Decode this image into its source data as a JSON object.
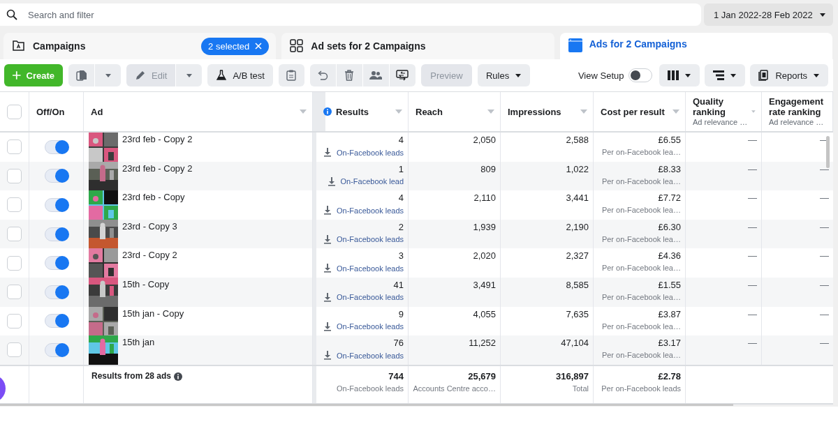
{
  "search": {
    "placeholder": "Search and filter"
  },
  "date_range": {
    "label": "1 Jan 2022-28 Feb 2022"
  },
  "tabs": [
    {
      "label": "Campaigns",
      "selected": false,
      "badge": "2 selected"
    },
    {
      "label": "Ad sets for 2 Campaigns",
      "selected": false
    },
    {
      "label": "Ads for 2 Campaigns",
      "selected": true
    }
  ],
  "toolbar": {
    "create": {
      "label": "Create"
    },
    "edit": {
      "label": "Edit",
      "disabled": true
    },
    "ab_test": {
      "label": "A/B test"
    },
    "preview": {
      "label": "Preview",
      "disabled": true
    },
    "rules": {
      "label": "Rules"
    },
    "view_setup": {
      "label": "View Setup",
      "on": false
    },
    "reports": {
      "label": "Reports"
    }
  },
  "table": {
    "select_all_checked": false,
    "columns": [
      {
        "label": "Off/On"
      },
      {
        "label": "Ad"
      },
      {
        "label": "Results",
        "info": true
      },
      {
        "label": "Reach"
      },
      {
        "label": "Impressions"
      },
      {
        "label": "Cost per result"
      },
      {
        "label": "Quality ranking",
        "sub": "Ad relevance …"
      },
      {
        "label": "Engagement rate ranking",
        "sub": "Ad relevance …"
      }
    ],
    "rows": [
      {
        "checked": false,
        "on": true,
        "name": "23rd feb - Copy 2",
        "results": "4",
        "result_type": "On-Facebook leads",
        "reach": "2,050",
        "impressions": "2,588",
        "cost": "£6.55",
        "cost_type": "Per on-Facebook lea…",
        "quality": "—",
        "engagement": "—"
      },
      {
        "checked": false,
        "on": true,
        "name": "23rd feb - Copy 2",
        "results": "1",
        "result_type": "On-Facebook lead",
        "reach": "809",
        "impressions": "1,022",
        "cost": "£8.33",
        "cost_type": "Per on-Facebook lea…",
        "quality": "—",
        "engagement": "—"
      },
      {
        "checked": false,
        "on": true,
        "name": "23rd feb - Copy",
        "results": "4",
        "result_type": "On-Facebook leads",
        "reach": "2,110",
        "impressions": "3,441",
        "cost": "£7.72",
        "cost_type": "Per on-Facebook lea…",
        "quality": "—",
        "engagement": "—"
      },
      {
        "checked": false,
        "on": true,
        "name": "23rd - Copy 3",
        "results": "2",
        "result_type": "On-Facebook leads",
        "reach": "1,939",
        "impressions": "2,190",
        "cost": "£6.30",
        "cost_type": "Per on-Facebook lea…",
        "quality": "—",
        "engagement": "—"
      },
      {
        "checked": false,
        "on": true,
        "name": "23rd - Copy 2",
        "results": "3",
        "result_type": "On-Facebook leads",
        "reach": "2,020",
        "impressions": "2,327",
        "cost": "£4.36",
        "cost_type": "Per on-Facebook lea…",
        "quality": "—",
        "engagement": "—"
      },
      {
        "checked": false,
        "on": true,
        "name": "15th - Copy",
        "results": "41",
        "result_type": "On-Facebook leads",
        "reach": "3,491",
        "impressions": "8,585",
        "cost": "£1.55",
        "cost_type": "Per on-Facebook lea…",
        "quality": "—",
        "engagement": "—"
      },
      {
        "checked": false,
        "on": true,
        "name": "15th jan - Copy",
        "results": "9",
        "result_type": "On-Facebook leads",
        "reach": "4,055",
        "impressions": "7,635",
        "cost": "£3.87",
        "cost_type": "Per on-Facebook lea…",
        "quality": "—",
        "engagement": "—"
      },
      {
        "checked": false,
        "on": true,
        "name": "15th jan",
        "results": "76",
        "result_type": "On-Facebook leads",
        "reach": "11,252",
        "impressions": "47,104",
        "cost": "£3.17",
        "cost_type": "Per on-Facebook lea…",
        "quality": "—",
        "engagement": "—"
      }
    ],
    "footer": {
      "label": "Results from 28 ads",
      "results": "744",
      "results_sub": "On-Facebook leads",
      "reach": "25,679",
      "reach_sub": "Accounts Centre acco…",
      "impressions": "316,897",
      "impressions_sub": "Total",
      "cost": "£2.78",
      "cost_sub": "Per on-Facebook leads"
    }
  }
}
